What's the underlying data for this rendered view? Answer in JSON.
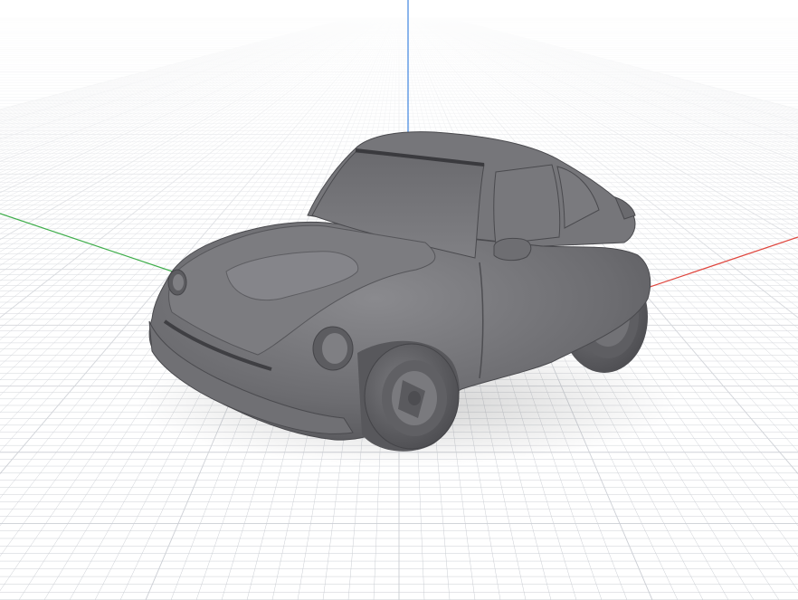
{
  "viewport": {
    "view": "perspective",
    "grid_visible": true,
    "background_color": "#ffffff",
    "grid_color": "#c9ccd2",
    "axes": {
      "x_color": "#e0473f",
      "y_color": "#3fae4b",
      "z_color": "#3f86e0"
    },
    "model": {
      "name": "car-model",
      "shading": "solid",
      "color": "#6e6e72"
    }
  }
}
